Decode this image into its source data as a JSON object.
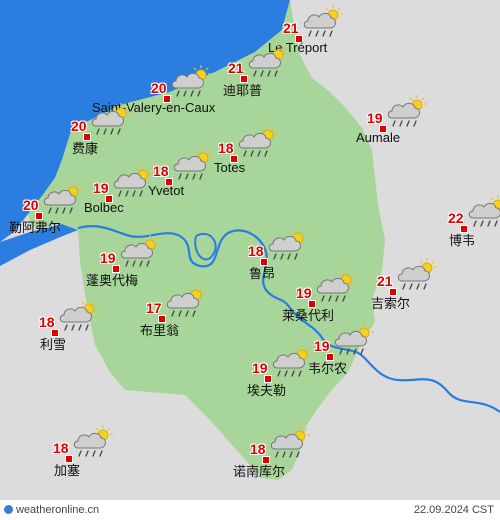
{
  "map": {
    "colors": {
      "sea": "#2b7de0",
      "region": "#a7d59a",
      "outside": "#dcdcdc",
      "river": "#2b7de0",
      "temp": "#e00000"
    },
    "icon": "cloud-rain-sun-icon"
  },
  "locations": [
    {
      "id": "le-treport",
      "name": "Le Tréport",
      "temp": "21",
      "icon": "cloud-rain-sun-icon"
    },
    {
      "id": "dieppe",
      "name": "迪耶普",
      "temp": "21",
      "icon": "cloud-rain-sun-icon"
    },
    {
      "id": "saint-valery",
      "name": "Saint-Valery-en-Caux",
      "temp": "20",
      "icon": "cloud-rain-sun-icon"
    },
    {
      "id": "aumale",
      "name": "Aumale",
      "temp": "19",
      "icon": "cloud-rain-sun-icon"
    },
    {
      "id": "fecamp",
      "name": "费康",
      "temp": "20",
      "icon": "cloud-rain-sun-icon"
    },
    {
      "id": "totes",
      "name": "Totes",
      "temp": "18",
      "icon": "cloud-rain-sun-icon"
    },
    {
      "id": "yvetot",
      "name": "Yvetot",
      "temp": "18",
      "icon": "cloud-rain-sun-icon"
    },
    {
      "id": "bolbec",
      "name": "Bolbec",
      "temp": "19",
      "icon": "cloud-rain-sun-icon"
    },
    {
      "id": "le-havre",
      "name": "勒阿弗尔",
      "temp": "20",
      "icon": "cloud-rain-sun-icon"
    },
    {
      "id": "beauvais",
      "name": "博韦",
      "temp": "22",
      "icon": "cloud-rain-sun-icon"
    },
    {
      "id": "pont-audemer",
      "name": "蓬奥代梅",
      "temp": "19",
      "icon": "cloud-rain-sun-icon"
    },
    {
      "id": "rouen",
      "name": "鲁昂",
      "temp": "18",
      "icon": "cloud-rain-sun-icon"
    },
    {
      "id": "gisors",
      "name": "吉索尔",
      "temp": "21",
      "icon": "cloud-rain-sun-icon"
    },
    {
      "id": "les-andelys",
      "name": "莱桑代利",
      "temp": "19",
      "icon": "cloud-rain-sun-icon"
    },
    {
      "id": "brionne",
      "name": "布里翁",
      "temp": "17",
      "icon": "cloud-rain-sun-icon"
    },
    {
      "id": "lisieux",
      "name": "利雪",
      "temp": "18",
      "icon": "cloud-rain-sun-icon"
    },
    {
      "id": "vernon",
      "name": "韦尔农",
      "temp": "19",
      "icon": "cloud-rain-sun-icon"
    },
    {
      "id": "evreux",
      "name": "埃夫勒",
      "temp": "19",
      "icon": "cloud-rain-sun-icon"
    },
    {
      "id": "gace",
      "name": "加塞",
      "temp": "18",
      "icon": "cloud-rain-sun-icon"
    },
    {
      "id": "nonancourt",
      "name": "诺南库尔",
      "temp": "18",
      "icon": "cloud-rain-sun-icon"
    }
  ],
  "footer": {
    "site": "weatheronline.cn",
    "timestamp": "22.09.2024 CST"
  }
}
